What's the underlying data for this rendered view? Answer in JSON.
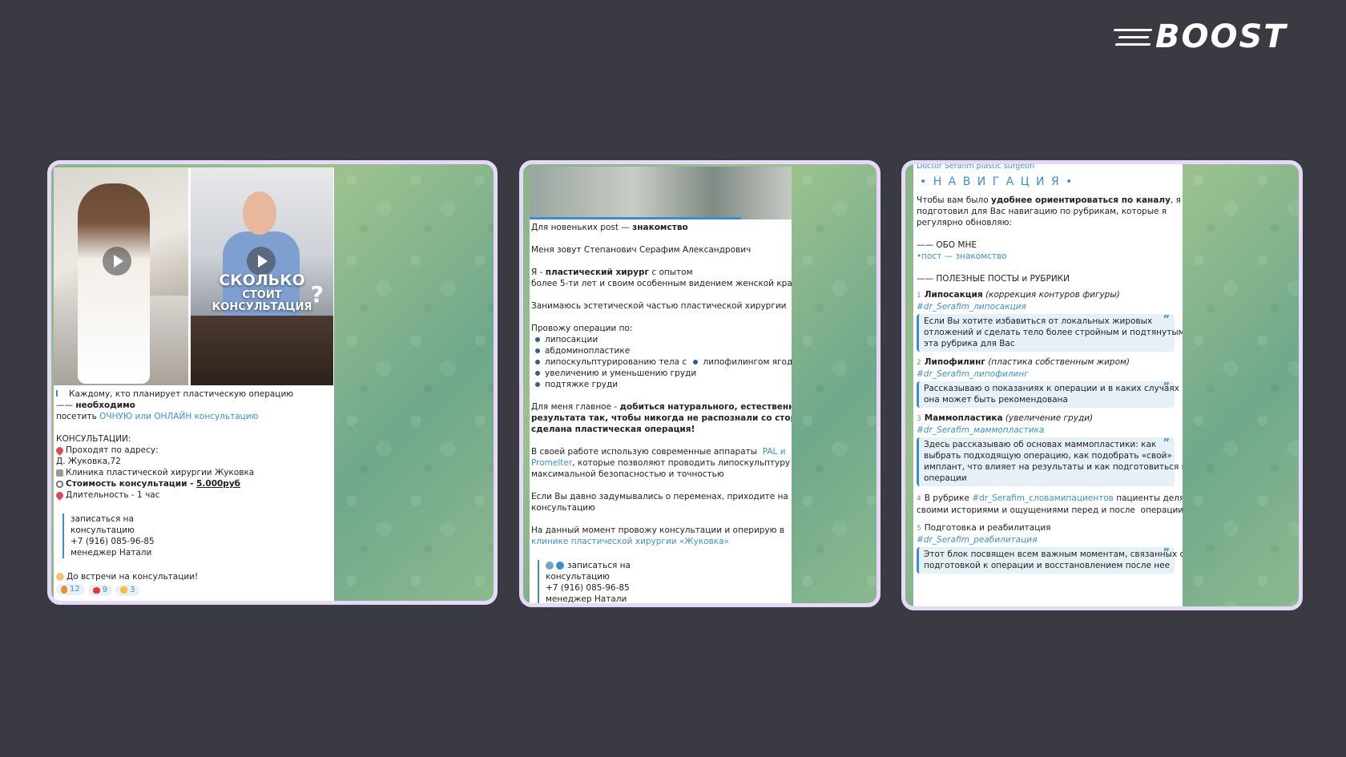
{
  "logo": {
    "text": "BOOST"
  },
  "card1": {
    "lines": [
      {
        "parts": [
          {
            "icon": "bullet-icon"
          },
          {
            "t": "Каждому, кто планирует пластическую операцию"
          }
        ]
      },
      {
        "parts": [
          {
            "t": "—— "
          },
          {
            "t": "необходимо",
            "b": true
          }
        ]
      },
      {
        "parts": [
          {
            "t": "посетить "
          },
          {
            "t": "ОЧНУЮ или ОНЛАЙН консультацию",
            "link": true
          }
        ]
      },
      {
        "parts": [
          {
            "t": ""
          }
        ]
      },
      {
        "parts": [
          {
            "t": "КОНСУЛЬТАЦИИ:"
          }
        ]
      },
      {
        "parts": [
          {
            "icon": "pin-icon"
          },
          {
            "t": "Проходят по адресу:"
          }
        ]
      },
      {
        "parts": [
          {
            "t": "Д. Жуковка,72"
          }
        ]
      },
      {
        "parts": [
          {
            "icon": "hospital-icon"
          },
          {
            "t": "Клиника пластической хирургии Жуковка"
          }
        ]
      },
      {
        "parts": [
          {
            "icon": "paperclip-icon"
          },
          {
            "t": "Стоимость консультации - ",
            "b": true
          },
          {
            "t": "5.000руб",
            "b": true,
            "u": true
          }
        ]
      },
      {
        "parts": [
          {
            "icon": "pin-icon"
          },
          {
            "t": "Длительность - 1 час"
          }
        ]
      },
      {
        "parts": [
          {
            "t": ""
          }
        ]
      }
    ],
    "quote": [
      "записаться на",
      "консультацию",
      "+7 (916) 085-96-85",
      "менеджер Натали"
    ],
    "footer": "До встречи на консультации!",
    "reactions": [
      {
        "icon": "fire-icon",
        "count": "12"
      },
      {
        "icon": "heart-icon",
        "count": "9"
      },
      {
        "icon": "clap-icon",
        "count": "3"
      }
    ],
    "video2": {
      "line1": "СКОЛЬКО",
      "line2": "СТОИТ",
      "line3": "КОНСУЛЬТАЦИЯ",
      "q": "?"
    }
  },
  "card2": {
    "lines": [
      {
        "parts": [
          {
            "t": "Для новеньких post — "
          },
          {
            "t": "знакомство",
            "b": true
          }
        ]
      },
      {
        "parts": [
          {
            "t": ""
          }
        ]
      },
      {
        "parts": [
          {
            "t": "Меня зовут Степанович Серафим Александрович"
          }
        ]
      },
      {
        "parts": [
          {
            "t": ""
          }
        ]
      },
      {
        "parts": [
          {
            "t": "Я - "
          },
          {
            "t": "пластический хирург",
            "b": true
          },
          {
            "t": " с опытом"
          }
        ]
      },
      {
        "parts": [
          {
            "t": "более 5-ти лет и своим особенным видением женской красоты"
          }
        ]
      },
      {
        "parts": [
          {
            "t": ""
          }
        ]
      },
      {
        "parts": [
          {
            "t": "Занимаюсь эстетической частью пластической хирургии"
          }
        ]
      },
      {
        "parts": [
          {
            "t": ""
          }
        ]
      },
      {
        "parts": [
          {
            "t": "Провожу операции по:"
          }
        ]
      },
      {
        "parts": [
          {
            "dot": true
          },
          {
            "t": "липосакции"
          }
        ]
      },
      {
        "parts": [
          {
            "dot": true
          },
          {
            "t": "абдоминопластике"
          }
        ]
      },
      {
        "parts": [
          {
            "dot": true
          },
          {
            "t": "липоскульптурированию тела с "
          },
          {
            "dot": true
          },
          {
            "t": "липофилингом ягодиц"
          }
        ]
      },
      {
        "parts": [
          {
            "dot": true
          },
          {
            "t": "увеличению и уменьшению груди"
          }
        ]
      },
      {
        "parts": [
          {
            "dot": true
          },
          {
            "t": "подтяжке груди"
          }
        ]
      },
      {
        "parts": [
          {
            "t": ""
          }
        ]
      },
      {
        "parts": [
          {
            "t": "Для меня главное - "
          },
          {
            "t": "добиться натурального, естественного",
            "b": true
          }
        ]
      },
      {
        "parts": [
          {
            "t": "результата так, чтобы никогда не распознали со стороны, что",
            "b": true
          }
        ]
      },
      {
        "parts": [
          {
            "t": "сделана пластическая операция!",
            "b": true
          }
        ]
      },
      {
        "parts": [
          {
            "t": ""
          }
        ]
      },
      {
        "parts": [
          {
            "t": "В своей работе использую современные аппараты  "
          },
          {
            "t": "PAL и",
            "link": true
          }
        ]
      },
      {
        "parts": [
          {
            "t": "Promelter",
            "link": true
          },
          {
            "t": ", которые позволяют проводить липоскульптуру с"
          }
        ]
      },
      {
        "parts": [
          {
            "t": "максимальной безопасностью и точностью"
          }
        ]
      },
      {
        "parts": [
          {
            "t": ""
          }
        ]
      },
      {
        "parts": [
          {
            "t": "Если Вы давно задумывались о переменах, приходите на"
          }
        ]
      },
      {
        "parts": [
          {
            "t": "консультацию"
          }
        ]
      },
      {
        "parts": [
          {
            "t": ""
          }
        ]
      },
      {
        "parts": [
          {
            "t": "На данный момент провожу консультации и оперирую в"
          }
        ]
      },
      {
        "parts": [
          {
            "t": "клинике пластической хирургии «Жуковка»",
            "link": true
          }
        ]
      },
      {
        "parts": [
          {
            "t": ""
          }
        ]
      }
    ],
    "quote": [
      "записаться на",
      "консультацию",
      "+7 (916) 085-96-85",
      "менеджер Натали"
    ]
  },
  "card3": {
    "channel": "Doctor Serafim plastic surgeon",
    "title": "• Н А В И Г А Ц И Я •",
    "intro": [
      {
        "parts": [
          {
            "t": "Чтобы вам было "
          },
          {
            "t": "удобнее ориентироваться по каналу",
            "b": true
          },
          {
            "t": ", я"
          }
        ]
      },
      {
        "parts": [
          {
            "t": "подготовил для Вас навигацию по рубрикам, которые я"
          }
        ]
      },
      {
        "parts": [
          {
            "t": "регулярно обновляю:"
          }
        ]
      },
      {
        "parts": [
          {
            "t": ""
          }
        ]
      },
      {
        "parts": [
          {
            "t": "—— ОБО МНЕ"
          }
        ]
      },
      {
        "parts": [
          {
            "t": "•пост — знакомство",
            "link": true
          }
        ]
      },
      {
        "parts": [
          {
            "t": ""
          }
        ]
      },
      {
        "parts": [
          {
            "t": "—— ПОЛЕЗНЫЕ ПОСТЫ и РУБРИКИ"
          }
        ]
      }
    ],
    "sections": [
      {
        "num": "1",
        "title": "Липосакция",
        "sub": " (коррекция контуров фигуры)",
        "tag": "#dr_Serafim_липосакция",
        "quote": [
          "Если Вы хотите избавиться от локальных жировых",
          "отложений и сделать тело более стройным и подтянутым,",
          "эта рубрика для Вас"
        ]
      },
      {
        "num": "2",
        "title": "Липофилинг",
        "sub": " (пластика собственным жиром)",
        "tag": "#dr_Serafim_липофилинг",
        "quote": [
          "Рассказываю о показаниях к операции и в каких случаях",
          "она может быть рекомендована"
        ]
      },
      {
        "num": "3",
        "title": "Маммопластика",
        "sub": " (увеличение груди)",
        "tag": "#dr_Serafim_маммопластика",
        "quote": [
          "Здесь рассказываю об основах маммопластики: как",
          "выбрать подходящую операцию, как подобрать «свой»",
          "имплант, что влияет на результаты и как подготовиться к",
          "операции"
        ]
      }
    ],
    "section4": {
      "num": "4",
      "pre": "В рубрике ",
      "tag": "#dr_Serafim_словамипациентов",
      "post": " пациенты делятся",
      "line2": "своими историями и ощущениями перед и после  операции"
    },
    "section5": {
      "num": "5",
      "title": "Подготовка и реабилитация",
      "tag": "#dr_Serafim_реабилитация",
      "quote": [
        "Этот блок посвящен всем важным моментам, связанных с",
        "подготовкой к операции и восстановлением после нее"
      ]
    }
  }
}
